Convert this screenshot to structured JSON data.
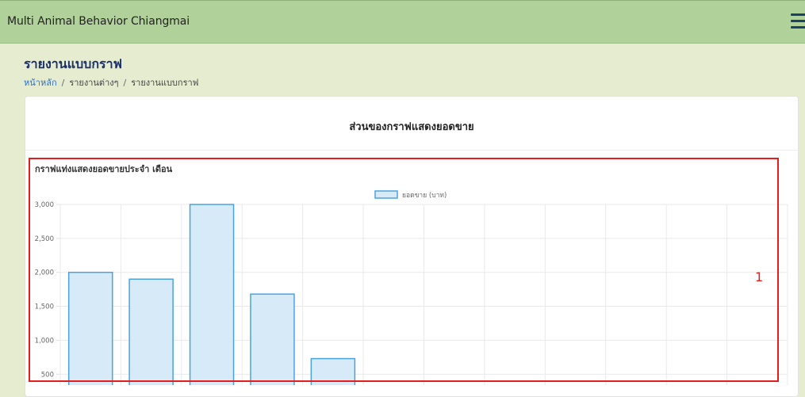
{
  "header": {
    "app_title": "Multi Animal Behavior Chiangmai",
    "menu_icon": "hamburger-menu-icon"
  },
  "page": {
    "title": "รายงานแบบกราฟ",
    "breadcrumb": [
      "หน้าหลัก",
      "รายงานต่างๆ",
      "รายงานแบบกราฟ"
    ],
    "breadcrumb_sep": "/"
  },
  "card": {
    "title": "ส่วนของกราฟแสดงยอดขาย",
    "chart_title": "กราฟแท่งแสดงยอดขายประจำ เดือน"
  },
  "annotation": {
    "label": "1",
    "color": "#e41c1c"
  },
  "colors": {
    "header_bg": "#b1d19b",
    "bar_fill": "#d6eaf8",
    "bar_stroke": "#4aa3df",
    "title_color": "#1a2f6b"
  },
  "chart_data": {
    "type": "bar",
    "categories": [
      "",
      "",
      "",
      "",
      "",
      "",
      "",
      "",
      "",
      "",
      "",
      ""
    ],
    "series": [
      {
        "name": "ยอดขาย (บาท)",
        "values": [
          2000,
          1900,
          3000,
          1680,
          730,
          0,
          0,
          0,
          0,
          0,
          0,
          0
        ]
      }
    ],
    "yticks": [
      "3,000",
      "2,500",
      "2,000",
      "1,500",
      "1,000",
      "500"
    ],
    "ylim": [
      0,
      3000
    ],
    "grid": true,
    "legend": "top-center"
  }
}
